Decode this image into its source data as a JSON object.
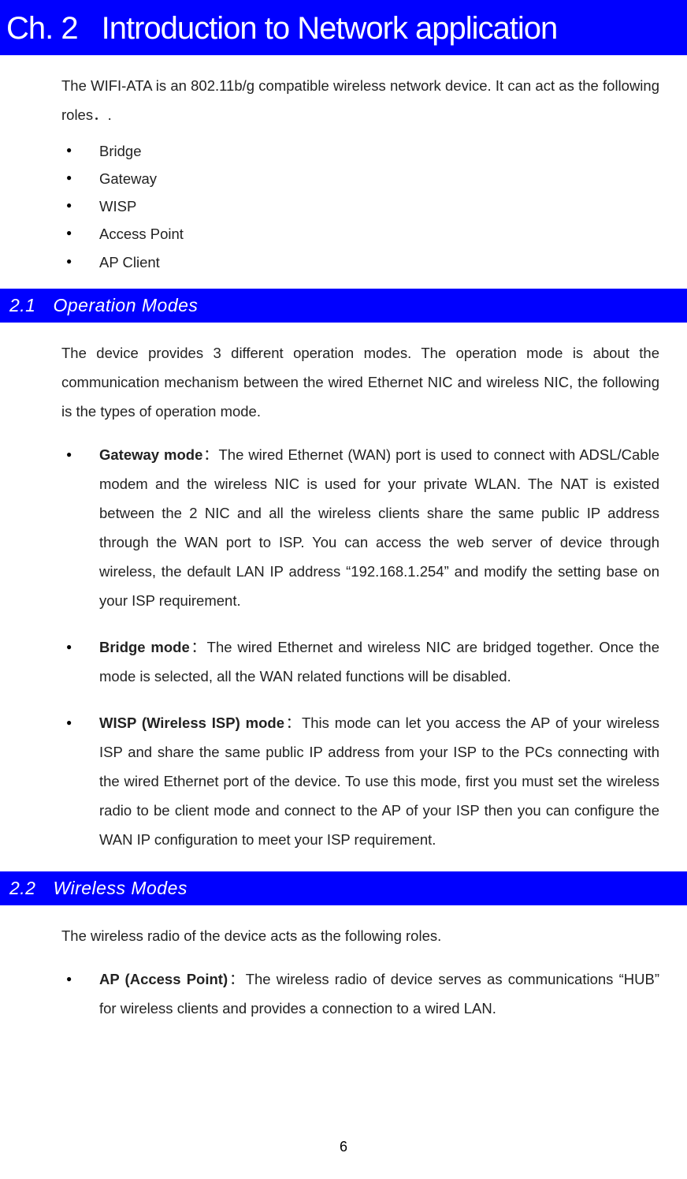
{
  "chapter": {
    "label_prefix": "Ch. 2",
    "title": "Introduction to Network application"
  },
  "intro": {
    "text": "The WIFI-ATA is an 802.11b/g compatible wireless network device. It can act as the following roles．.",
    "bullets": [
      "Bridge",
      "Gateway",
      "WISP",
      "Access Point",
      "AP Client"
    ]
  },
  "section_2_1": {
    "num": "2.1",
    "title": "Operation Modes",
    "intro": "The device provides 3 different operation modes. The operation mode is about the communication mechanism between the wired Ethernet NIC and wireless NIC, the following is the types of operation mode.",
    "items": [
      {
        "term": "Gateway mode",
        "sep": "：",
        "desc": "The wired Ethernet (WAN) port is used to connect with ADSL/Cable modem and the wireless NIC is used for your private WLAN. The NAT is existed between the 2 NIC and all the wireless clients share the same public IP address through the WAN port to ISP. You can access the web server of device through wireless, the default LAN IP address “192.168.1.254” and modify the setting base on your ISP requirement."
      },
      {
        "term": "Bridge mode",
        "sep": "：",
        "desc": "The wired Ethernet and wireless NIC are bridged together. Once the mode is selected, all the WAN related functions will be disabled."
      },
      {
        "term": "WISP (Wireless ISP) mode",
        "sep": "：",
        "desc": "This mode can let you access the AP of your wireless ISP and share the same public IP address from your ISP to the PCs connecting with the wired Ethernet port of the device. To use this mode, first you must set the wireless radio to be client mode and connect to the AP of your ISP then you can configure the WAN IP configuration to meet your ISP requirement."
      }
    ]
  },
  "section_2_2": {
    "num": "2.2",
    "title": "Wireless Modes",
    "intro": "The wireless radio of the device acts as the following roles.",
    "items": [
      {
        "term": "AP (Access Point)",
        "sep": "：",
        "desc": "The wireless radio of device serves as communications “HUB” for wireless clients and provides a connection to a wired LAN."
      }
    ]
  },
  "page_number": "6"
}
